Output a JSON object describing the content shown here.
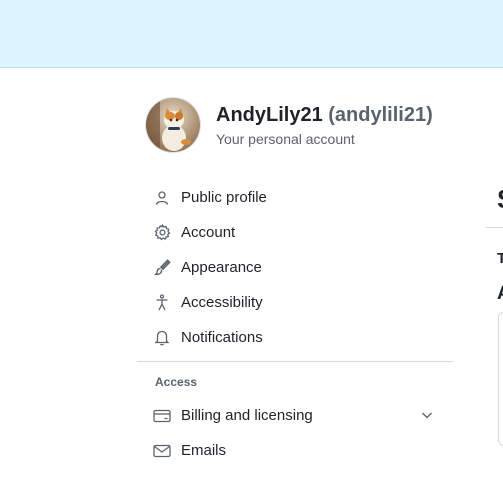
{
  "account": {
    "display_name": "AndyLily21",
    "login": "(andylili21)",
    "subtitle": "Your personal account"
  },
  "nav": {
    "items": [
      {
        "label": "Public profile",
        "icon": "person-icon"
      },
      {
        "label": "Account",
        "icon": "gear-icon"
      },
      {
        "label": "Appearance",
        "icon": "paintbrush-icon"
      },
      {
        "label": "Accessibility",
        "icon": "accessibility-icon"
      },
      {
        "label": "Notifications",
        "icon": "bell-icon"
      }
    ],
    "access_heading": "Access",
    "access_items": [
      {
        "label": "Billing and licensing",
        "icon": "credit-card-icon",
        "expandable": true
      },
      {
        "label": "Emails",
        "icon": "mail-icon"
      }
    ]
  },
  "colors": {
    "banner_bg": "#ddf4ff",
    "text": "#1f2328",
    "muted": "#59636e",
    "border": "#d1d9e0"
  }
}
